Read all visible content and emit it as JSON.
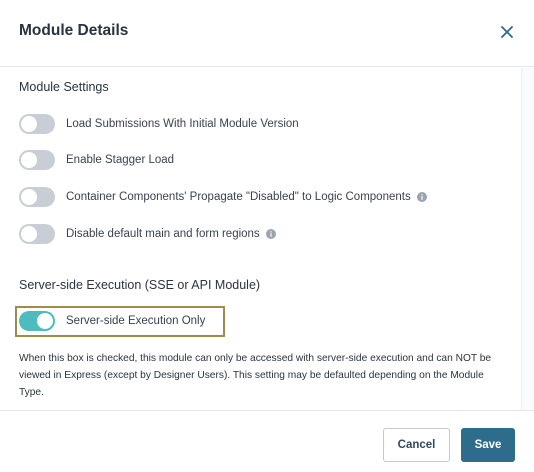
{
  "dialog": {
    "title": "Module Details"
  },
  "module_settings": {
    "heading": "Module Settings",
    "toggles": [
      {
        "label": "Load Submissions With Initial Module Version",
        "on": false,
        "info": false
      },
      {
        "label": "Enable Stagger Load",
        "on": false,
        "info": false
      },
      {
        "label": "Container Components' Propagate \"Disabled\" to Logic Components",
        "on": false,
        "info": true
      },
      {
        "label": "Disable default main and form regions",
        "on": false,
        "info": true
      }
    ]
  },
  "sse": {
    "heading": "Server-side Execution (SSE or API Module)",
    "toggle_label": "Server-side Execution Only",
    "toggle_on": true,
    "help_text": "When this box is checked, this module can only be accessed with server-side execution and can NOT be viewed in Express (except by Designer Users). This setting may be defaulted depending on the Module Type."
  },
  "footer": {
    "cancel_label": "Cancel",
    "save_label": "Save"
  },
  "colors": {
    "accent": "#2e6c8c",
    "toggle_on": "#4dbcbf",
    "toggle_off": "#c9ced6",
    "focus_outline": "#a08a4e"
  }
}
